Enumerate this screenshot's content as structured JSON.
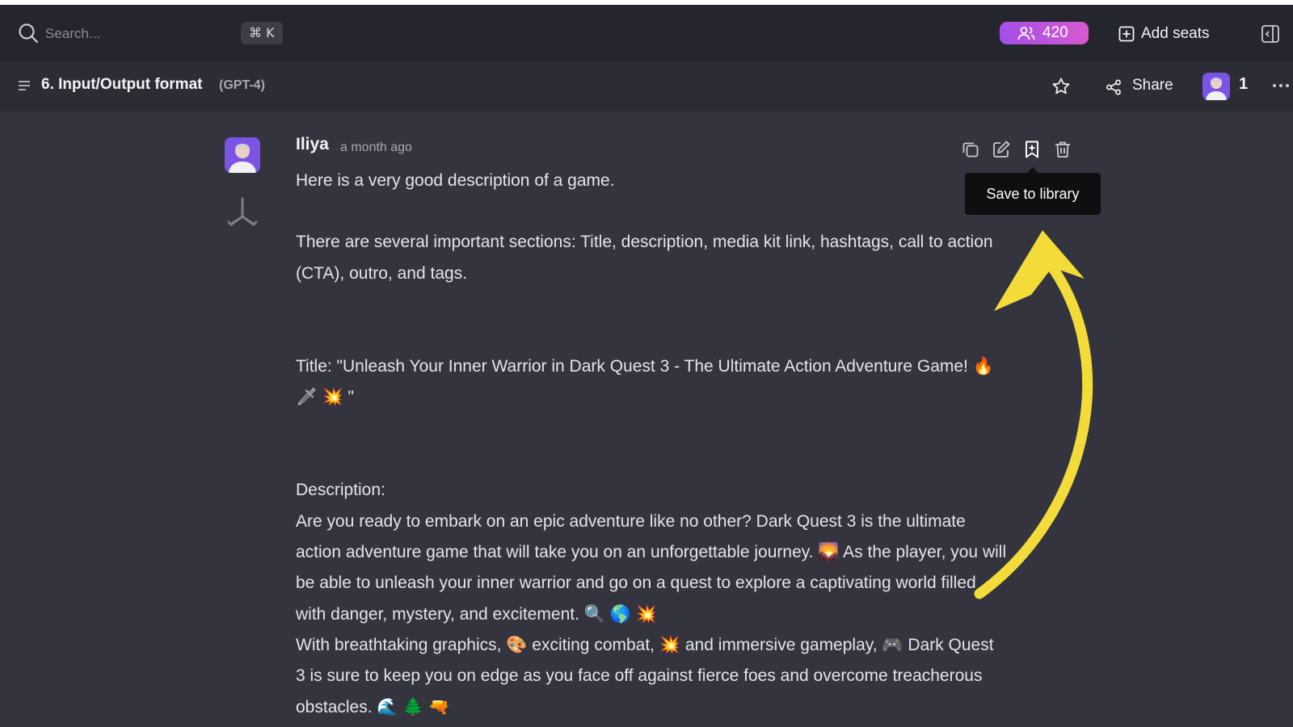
{
  "topbar": {
    "search_placeholder": "Search...",
    "shortcut": "⌘ K",
    "seats_count": "420",
    "add_seats_label": "Add seats"
  },
  "conversation": {
    "title": "6. Input/Output format",
    "model": "(GPT-4)",
    "share_label": "Share",
    "member_count": "1"
  },
  "message": {
    "author": "Iliya",
    "timestamp": "a month ago",
    "tooltip": "Save to library",
    "paragraphs": [
      "Here is a very good description of a game.",
      "There are several important sections: Title, description, media kit link, hashtags, call to action (CTA), outro, and tags.",
      "Title: \"Unleash Your Inner Warrior in Dark Quest 3 - The Ultimate Action Adventure Game! 🔥 🗡 💥 \"",
      "Description:",
      "Are you ready to embark on an epic adventure like no other? Dark Quest 3 is the ultimate action adventure game that will take you on an unforgettable journey. 🌄 As the player, you will be able to unleash your inner warrior and go on a quest to explore a captivating world filled with danger, mystery, and excitement. 🔍 🌎 💥",
      "With breathtaking graphics, 🎨 exciting combat, 💥 and immersive gameplay, 🎮 Dark Quest 3 is sure to keep you on edge as you face off against fierce foes and overcome treacherous obstacles. 🌊 🌲 🔫"
    ]
  },
  "colors": {
    "accent_gradient_start": "#a34ee8",
    "accent_gradient_end": "#d75ad0",
    "avatar_bg": "#7b54e6",
    "annotation_arrow": "#f3dc3a"
  },
  "icons": [
    "search-icon",
    "users-icon",
    "plus-square-icon",
    "sidebar-toggle-icon",
    "menu-icon",
    "star-icon",
    "share-icon",
    "more-icon",
    "branch-icon",
    "copy-icon",
    "edit-icon",
    "bookmark-plus-icon",
    "trash-icon"
  ]
}
